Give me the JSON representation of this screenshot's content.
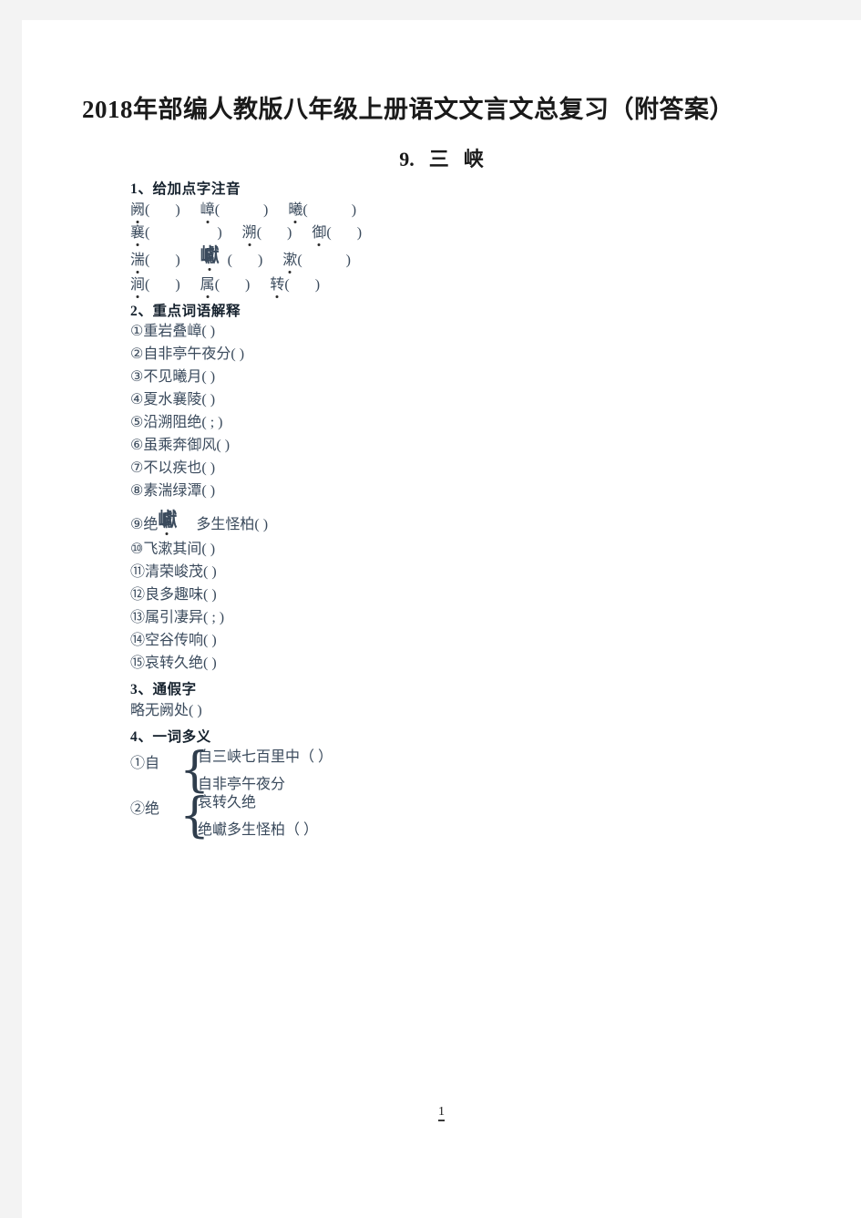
{
  "document": {
    "title": "2018年部编人教版八年级上册语文文言文总复习（附答案）",
    "subtitle_number": "9.",
    "subtitle_text_a": "三",
    "subtitle_text_b": "峡",
    "page_number": "1"
  },
  "sections": {
    "pronunciation": {
      "heading": "1、给加点字注音",
      "rows": [
        {
          "items": [
            {
              "char": "阙",
              "big": false
            },
            {
              "char": "嶂",
              "big": false
            },
            {
              "char": "曦",
              "big": false
            }
          ]
        },
        {
          "items": [
            {
              "char": "襄",
              "big": false
            },
            {
              "char": "溯",
              "big": false
            },
            {
              "char": "御",
              "big": false
            }
          ]
        },
        {
          "items": [
            {
              "char": "湍",
              "big": false
            },
            {
              "char": "巘",
              "big": true
            },
            {
              "char": "漱",
              "big": false
            }
          ]
        },
        {
          "items": [
            {
              "char": "涧",
              "big": false
            },
            {
              "char": "属",
              "big": false
            },
            {
              "char": "转",
              "big": false
            }
          ]
        }
      ]
    },
    "keywords": {
      "heading": "2、重点词语解释",
      "items": [
        {
          "num": "①",
          "text": "重岩叠嶂",
          "paren": "(                )"
        },
        {
          "num": "②",
          "text": "自非亭午夜分",
          "paren": "(            )"
        },
        {
          "num": "③",
          "text": "不见曦月",
          "paren": "(               )"
        },
        {
          "num": "④",
          "text": "夏水襄陵",
          "paren": "(             )"
        },
        {
          "num": "⑤",
          "text": "沿溯阻绝",
          "paren": "(          ;            )"
        },
        {
          "num": "⑥",
          "text": "虽乘奔御风",
          "paren": "(          )"
        },
        {
          "num": "⑦",
          "text": "不以疾也",
          "paren": "(                 )"
        },
        {
          "num": "⑧",
          "text": "素湍绿潭",
          "paren": "(             )"
        },
        {
          "num": "⑨",
          "text": "绝巘多生怪柏",
          "paren": "(          )"
        },
        {
          "num": "⑩",
          "text": "飞漱其间",
          "paren": "(        )"
        },
        {
          "num": "⑪",
          "text": "清荣峻茂",
          "paren": "(         )"
        },
        {
          "num": "⑫",
          "text": "良多趣味",
          "paren": "(            )"
        },
        {
          "num": "⑬",
          "text": "属引凄异",
          "paren": "(        ;        )"
        },
        {
          "num": "⑭",
          "text": "空谷传响",
          "paren": "(       )"
        },
        {
          "num": "⑮",
          "text": "哀转久绝",
          "paren": "(             )"
        }
      ]
    },
    "tongjia": {
      "heading": "3、通假字",
      "entry_text": "略无阙处",
      "entry_paren": "(                    )"
    },
    "polysemy": {
      "heading": "4、一词多义",
      "groups": [
        {
          "num": "①",
          "key": "自",
          "lines": [
            {
              "text": "自三峡七百里中",
              "paren": "（             ）"
            },
            {
              "text": "自非亭午夜分",
              "paren": ""
            }
          ]
        },
        {
          "num": "②",
          "key": "绝",
          "lines": [
            {
              "text": "哀转久绝",
              "paren": ""
            },
            {
              "text": "绝巘多生怪柏",
              "paren": "（        ）"
            }
          ]
        }
      ]
    }
  }
}
